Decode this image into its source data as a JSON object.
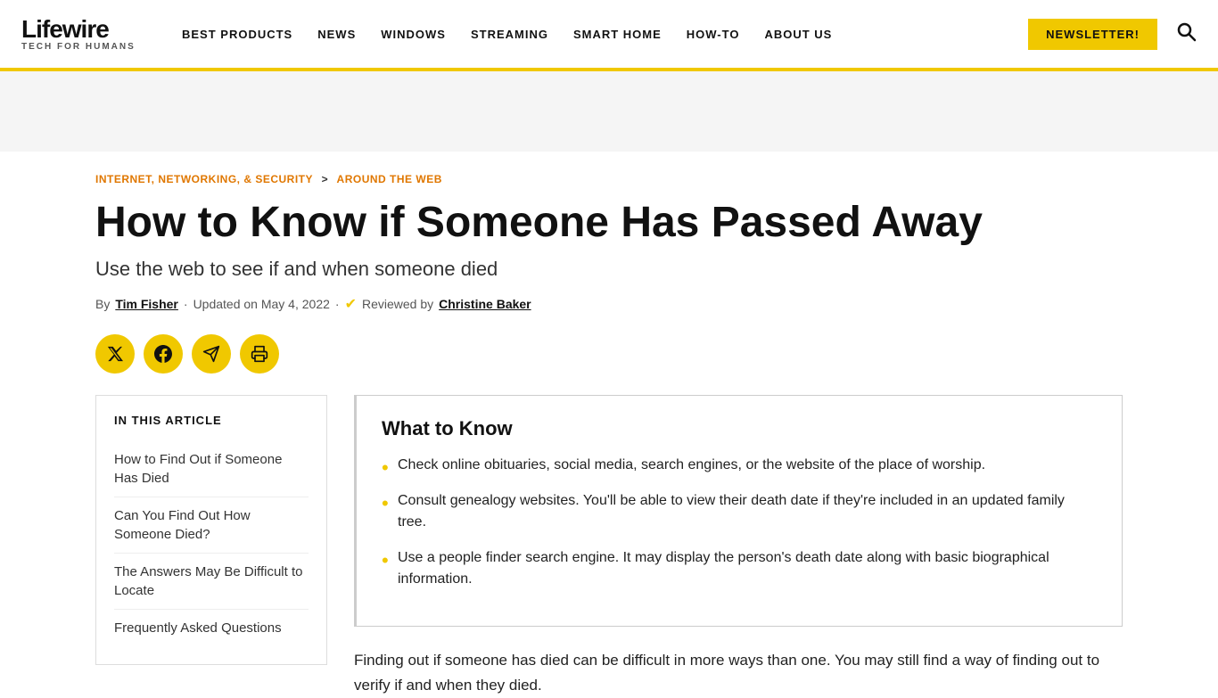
{
  "header": {
    "logo": "Lifewire",
    "tagline": "TECH FOR HUMANS",
    "nav": [
      {
        "label": "BEST PRODUCTS",
        "id": "best-products"
      },
      {
        "label": "NEWS",
        "id": "news"
      },
      {
        "label": "WINDOWS",
        "id": "windows"
      },
      {
        "label": "STREAMING",
        "id": "streaming"
      },
      {
        "label": "SMART HOME",
        "id": "smart-home"
      },
      {
        "label": "HOW-TO",
        "id": "how-to"
      },
      {
        "label": "ABOUT US",
        "id": "about-us"
      }
    ],
    "newsletter_label": "NEWSLETTER!",
    "search_aria": "Search"
  },
  "breadcrumb": {
    "parent": "INTERNET, NETWORKING, & SECURITY",
    "separator": ">",
    "current": "AROUND THE WEB"
  },
  "article": {
    "title": "How to Know if Someone Has Passed Away",
    "subtitle": "Use the web to see if and when someone died",
    "meta": {
      "by_label": "By",
      "author": "Tim Fisher",
      "updated_label": "Updated on May 4, 2022",
      "reviewed_label": "Reviewed by",
      "reviewer": "Christine Baker"
    },
    "share_buttons": [
      {
        "id": "twitter",
        "icon": "𝕏",
        "aria": "Share on Twitter"
      },
      {
        "id": "facebook",
        "icon": "f",
        "aria": "Share on Facebook"
      },
      {
        "id": "telegram",
        "icon": "✈",
        "aria": "Share on Telegram"
      },
      {
        "id": "print",
        "icon": "⎙",
        "aria": "Print"
      }
    ]
  },
  "toc": {
    "title": "IN THIS ARTICLE",
    "items": [
      {
        "label": "How to Find Out if Someone Has Died",
        "id": "toc-1"
      },
      {
        "label": "Can You Find Out How Someone Died?",
        "id": "toc-2"
      },
      {
        "label": "The Answers May Be Difficult to Locate",
        "id": "toc-3"
      },
      {
        "label": "Frequently Asked Questions",
        "id": "toc-4"
      }
    ]
  },
  "what_to_know": {
    "title": "What to Know",
    "points": [
      "Check online obituaries, social media, search engines, or the website of the place of worship.",
      "Consult genealogy websites. You'll be able to view their death date if they're included in an updated family tree.",
      "Use a people finder search engine. It may display the person's death date along with basic biographical information."
    ]
  },
  "body_text": "Finding out if someone has died can be difficult in more ways than one. You may still find a way of finding out to verify if and when they died."
}
